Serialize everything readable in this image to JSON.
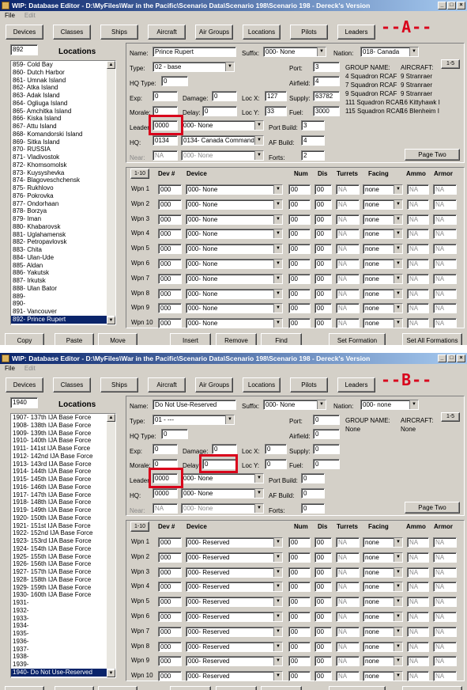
{
  "windows": [
    {
      "id": "A",
      "title": "WIP: Database Editor - D:\\MyFiles\\War in the Pacific\\Scenario Data\\Scenario 198\\Scenario 198 - Dereck's Version",
      "menu": [
        "File",
        "Edit"
      ],
      "tabs": [
        "Devices",
        "Classes",
        "Ships",
        "Aircraft",
        "Air Groups",
        "Locations",
        "Pilots",
        "Leaders"
      ],
      "marker": "--A--",
      "list_search": "892",
      "list_title": "Locations",
      "list_items": [
        "859- Cold Bay",
        "860- Dutch Harbor",
        "861- Umnak Island",
        "862- Atka Island",
        "863- Adak Island",
        "864- Ogliuga Island",
        "865- Amchitka Island",
        "866- Kiska Island",
        "867- Attu Island",
        "868- Komandorski Island",
        "869- Sitka Island",
        "870- RUSSIA",
        "871- Vladivostok",
        "872- Khomsomolsk",
        "873- Kuysyshevka",
        "874- Blagoveschchensk",
        "875- Rukhlovo",
        "876- Pokrovka",
        "877- Ondorhaan",
        "878- Borzya",
        "879- Iman",
        "880- Khabarovsk",
        "881- Uglahamensk",
        "882- Petropavlovsk",
        "883- Chita",
        "884- Ulan-Ude",
        "885- Aldan",
        "886- Yakutsk",
        "887- Irkutsk",
        "888- Ulan Bator",
        "889-",
        "890-",
        "891- Vancouver",
        "892- Prince Rupert"
      ],
      "selected_index": 33,
      "name": "Prince Rupert",
      "suffix": "000- None",
      "nation": "018- Canada",
      "type": "02 - base",
      "hq_type": "0",
      "port": "3",
      "airfield": "4",
      "exp": "0",
      "damage": "0",
      "loc_x": "127",
      "supply": "63782",
      "morale": "0",
      "delay": "0",
      "loc_y": "33",
      "fuel": "3000",
      "leader": "0000",
      "leader_name": "000- None",
      "port_build": "3",
      "hq": "0134",
      "hq_name": "0134- Canada Command",
      "af_build": "4",
      "near": "NA",
      "near_name": "000- None",
      "forts": "2",
      "group_header": "GROUP NAME:",
      "aircraft_header": "AIRCRAFT:",
      "range_btn": "1-5",
      "groups": [
        [
          "4 Squadron RCAF",
          "9 Stranraer"
        ],
        [
          "7 Squadron RCAF",
          "9 Stranraer"
        ],
        [
          "9 Squadron RCAF",
          "9 Stranraer"
        ],
        [
          "111 Squadron RCAF",
          "16 Kittyhawk I"
        ],
        [
          "115 Squadron RCAF",
          "16 Blenheim I"
        ]
      ],
      "page_two": "Page Two",
      "weapons_range": "1-10",
      "weapon_headers": {
        "dev": "Dev #",
        "device": "Device",
        "num": "Num",
        "dis": "Dis",
        "turrets": "Turrets",
        "facing": "Facing",
        "ammo": "Ammo",
        "armor": "Armor"
      },
      "weapons": [
        {
          "label": "Wpn 1",
          "dev": "000",
          "device": "000- None",
          "num": "00",
          "dis": "00",
          "turrets": "NA",
          "facing": "none",
          "ammo": "NA",
          "armor": "NA"
        },
        {
          "label": "Wpn 2",
          "dev": "000",
          "device": "000- None",
          "num": "00",
          "dis": "00",
          "turrets": "NA",
          "facing": "none",
          "ammo": "NA",
          "armor": "NA"
        },
        {
          "label": "Wpn 3",
          "dev": "000",
          "device": "000- None",
          "num": "00",
          "dis": "00",
          "turrets": "NA",
          "facing": "none",
          "ammo": "NA",
          "armor": "NA"
        },
        {
          "label": "Wpn 4",
          "dev": "000",
          "device": "000- None",
          "num": "00",
          "dis": "00",
          "turrets": "NA",
          "facing": "none",
          "ammo": "NA",
          "armor": "NA"
        },
        {
          "label": "Wpn 5",
          "dev": "000",
          "device": "000- None",
          "num": "00",
          "dis": "00",
          "turrets": "NA",
          "facing": "none",
          "ammo": "NA",
          "armor": "NA"
        },
        {
          "label": "Wpn 6",
          "dev": "000",
          "device": "000- None",
          "num": "00",
          "dis": "00",
          "turrets": "NA",
          "facing": "none",
          "ammo": "NA",
          "armor": "NA"
        },
        {
          "label": "Wpn 7",
          "dev": "000",
          "device": "000- None",
          "num": "00",
          "dis": "00",
          "turrets": "NA",
          "facing": "none",
          "ammo": "NA",
          "armor": "NA"
        },
        {
          "label": "Wpn 8",
          "dev": "000",
          "device": "000- None",
          "num": "00",
          "dis": "00",
          "turrets": "NA",
          "facing": "none",
          "ammo": "NA",
          "armor": "NA"
        },
        {
          "label": "Wpn 9",
          "dev": "000",
          "device": "000- None",
          "num": "00",
          "dis": "00",
          "turrets": "NA",
          "facing": "none",
          "ammo": "NA",
          "armor": "NA"
        },
        {
          "label": "Wpn 10",
          "dev": "000",
          "device": "000- None",
          "num": "00",
          "dis": "00",
          "turrets": "NA",
          "facing": "none",
          "ammo": "NA",
          "armor": "NA"
        }
      ],
      "bottom_buttons": [
        "Copy",
        "Paste",
        "Move",
        "Insert",
        "Remove",
        "Find",
        "Set Formation",
        "Set All Formations"
      ]
    },
    {
      "id": "B",
      "title": "WIP: Database Editor - D:\\MyFiles\\War in the Pacific\\Scenario Data\\Scenario 198\\Scenario 198 - Dereck's Version",
      "menu": [
        "File",
        "Edit"
      ],
      "tabs": [
        "Devices",
        "Classes",
        "Ships",
        "Aircraft",
        "Air Groups",
        "Locations",
        "Pilots",
        "Leaders"
      ],
      "marker": "--B--",
      "list_search": "1940",
      "list_title": "Locations",
      "list_items": [
        "1907- 137th IJA Base Force",
        "1908- 138th IJA Base Force",
        "1909- 139th IJA Base Force",
        "1910- 140th IJA Base Force",
        "1911- 141st IJA Base Force",
        "1912- 142nd IJA Base Force",
        "1913- 143rd IJA Base Force",
        "1914- 144th IJA Base Force",
        "1915- 145th IJA Base Force",
        "1916- 146th IJA Base Force",
        "1917- 147th IJA Base Force",
        "1918- 148th IJA Base Force",
        "1919- 149th IJA Base Force",
        "1920- 150th IJA Base Force",
        "1921- 151st IJA Base Force",
        "1922- 152nd IJA Base Force",
        "1923- 153rd IJA Base Force",
        "1924- 154th IJA Base Force",
        "1925- 155th IJA Base Force",
        "1926- 156th IJA Base Force",
        "1927- 157th IJA Base Force",
        "1928- 158th IJA Base Force",
        "1929- 159th IJA Base Force",
        "1930- 160th IJA Base Force",
        "1931-",
        "1932-",
        "1933-",
        "1934-",
        "1935-",
        "1936-",
        "1937-",
        "1938-",
        "1939-",
        "1940- Do Not Use-Reserved"
      ],
      "selected_index": 33,
      "name": "Do Not Use-Reserved",
      "suffix": "000- None",
      "nation": "000- none",
      "type": "01 - ---",
      "hq_type": "0",
      "port": "0",
      "airfield": "0",
      "exp": "0",
      "damage": "0",
      "loc_x": "0",
      "supply": "0",
      "morale": "0",
      "delay": "0",
      "loc_y": "0",
      "fuel": "0",
      "leader": "0000",
      "leader_name": "000- None",
      "port_build": "0",
      "hq": "0000",
      "hq_name": "000- None",
      "af_build": "0",
      "near": "NA",
      "near_name": "000- None",
      "forts": "0",
      "group_header": "GROUP NAME:",
      "aircraft_header": "AIRCRAFT:",
      "range_btn": "1-5",
      "groups": [
        [
          "None",
          "None"
        ]
      ],
      "page_two": "Page Two",
      "weapons_range": "1-10",
      "weapon_headers": {
        "dev": "Dev #",
        "device": "Device",
        "num": "Num",
        "dis": "Dis",
        "turrets": "Turrets",
        "facing": "Facing",
        "ammo": "Ammo",
        "armor": "Armor"
      },
      "weapons": [
        {
          "label": "Wpn 1",
          "dev": "000",
          "device": "000- Reserved",
          "num": "00",
          "dis": "00",
          "turrets": "NA",
          "facing": "none",
          "ammo": "NA",
          "armor": "NA"
        },
        {
          "label": "Wpn 2",
          "dev": "000",
          "device": "000- Reserved",
          "num": "00",
          "dis": "00",
          "turrets": "NA",
          "facing": "none",
          "ammo": "NA",
          "armor": "NA"
        },
        {
          "label": "Wpn 3",
          "dev": "000",
          "device": "000- Reserved",
          "num": "00",
          "dis": "00",
          "turrets": "NA",
          "facing": "none",
          "ammo": "NA",
          "armor": "NA"
        },
        {
          "label": "Wpn 4",
          "dev": "000",
          "device": "000- Reserved",
          "num": "00",
          "dis": "00",
          "turrets": "NA",
          "facing": "none",
          "ammo": "NA",
          "armor": "NA"
        },
        {
          "label": "Wpn 5",
          "dev": "000",
          "device": "000- Reserved",
          "num": "00",
          "dis": "00",
          "turrets": "NA",
          "facing": "none",
          "ammo": "NA",
          "armor": "NA"
        },
        {
          "label": "Wpn 6",
          "dev": "000",
          "device": "000- Reserved",
          "num": "00",
          "dis": "00",
          "turrets": "NA",
          "facing": "none",
          "ammo": "NA",
          "armor": "NA"
        },
        {
          "label": "Wpn 7",
          "dev": "000",
          "device": "000- Reserved",
          "num": "00",
          "dis": "00",
          "turrets": "NA",
          "facing": "none",
          "ammo": "NA",
          "armor": "NA"
        },
        {
          "label": "Wpn 8",
          "dev": "000",
          "device": "000- Reserved",
          "num": "00",
          "dis": "00",
          "turrets": "NA",
          "facing": "none",
          "ammo": "NA",
          "armor": "NA"
        },
        {
          "label": "Wpn 9",
          "dev": "000",
          "device": "000- Reserved",
          "num": "00",
          "dis": "00",
          "turrets": "NA",
          "facing": "none",
          "ammo": "NA",
          "armor": "NA"
        },
        {
          "label": "Wpn 10",
          "dev": "000",
          "device": "000- Reserved",
          "num": "00",
          "dis": "00",
          "turrets": "NA",
          "facing": "none",
          "ammo": "NA",
          "armor": "NA"
        }
      ],
      "bottom_buttons": []
    }
  ],
  "accent": {
    "title_bar": "#0a246a",
    "selection": "#0a246a",
    "highlight": "#d9001b",
    "face": "#d4d0c8"
  }
}
